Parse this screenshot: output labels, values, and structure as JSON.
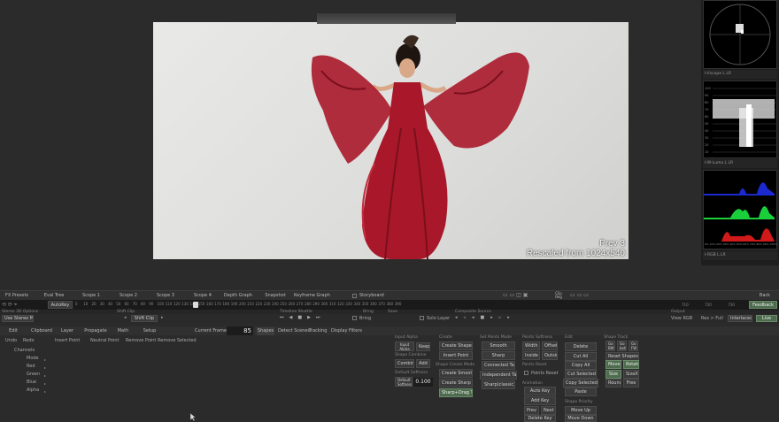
{
  "viewer": {
    "overlay_title": "Prev 3",
    "overlay_sub": "Rescaled from 1024x540"
  },
  "scopes": {
    "vscope_label": "I-Vscope  L LR",
    "luma_label": "I-W-Luma  L LR",
    "rgb_label": "I-RGB  L LR",
    "luma_ticks": [
      "100",
      "90",
      "80",
      "70",
      "60",
      "50",
      "40",
      "30",
      "20",
      "10"
    ],
    "rgb_ticks": [
      "0%",
      "10%",
      "20%",
      "30%",
      "40%",
      "50%",
      "60%",
      "70%",
      "80%",
      "90%",
      "100%"
    ]
  },
  "toolbar": {
    "tabs": [
      "FX Presets",
      "Eval Tree",
      "Scope 1",
      "Scope 2",
      "Scope 3",
      "Scope 4",
      "Depth Graph",
      "Snapshot",
      "Keyframe Graph"
    ],
    "storyboard": "Storyboard",
    "clip_reg": "Clip\nReg",
    "back": "Back"
  },
  "timeline": {
    "autokey": "AutoKey",
    "ticks": [
      "0",
      "10",
      "20",
      "30",
      "40",
      "50",
      "60",
      "70",
      "80",
      "90",
      "100",
      "110",
      "120",
      "130",
      "140",
      "150",
      "160",
      "170",
      "180",
      "190",
      "200",
      "210",
      "220",
      "230",
      "240",
      "250",
      "260",
      "270",
      "280",
      "290",
      "300",
      "310",
      "320",
      "330",
      "340",
      "350",
      "360",
      "370",
      "380",
      "390"
    ],
    "feedback": "Feedback",
    "end_ticks": [
      "710",
      "720",
      "730"
    ]
  },
  "row3": {
    "stereo": "Stereo 3D Options",
    "shift_clip_hdr": "Shift Clip",
    "timeline_shuttle": "Timeline Shuttle",
    "bring": "Bring",
    "save": "Save",
    "composite_source": "Composite Source",
    "output": "Output"
  },
  "row4": {
    "use_stereo": "Use Stereo Mode",
    "shift_clip": "Shift Clip",
    "bring": "Bring",
    "solo_layer": "Solo Layer",
    "view_rgb": "View  RGB",
    "res_full": "Res > Full",
    "interlaced": "Interlaced",
    "live": "Live"
  },
  "tabs2": {
    "items": [
      "Edit",
      "Clipboard",
      "Layer",
      "Propagate",
      "Math",
      "Setup"
    ],
    "current_frame_label": "Current Frame",
    "current_frame": "85",
    "right": [
      "Shapes",
      "Detect Scenes",
      "Tracking",
      "Display Filters"
    ]
  },
  "left_panel": {
    "undo": "Undo",
    "redo": "Redo",
    "insert_point": "Insert Point",
    "neutral_point": "Neutral Point",
    "remove_point": "Remove Point",
    "remove_selected": "Remove Selected",
    "channels_label": "Channels",
    "channels": [
      "Mode",
      "Red",
      "Green",
      "Blue",
      "Alpha"
    ]
  },
  "right_panel": {
    "input_alpha_hdr": "Input Alpha",
    "input_alpha": "Input Alpha",
    "keep": "Keep",
    "shape_combine_hdr": "Shape Combine",
    "combine": "Combine",
    "add": "Add",
    "default_softness_hdr": "Default Softness",
    "default_softness": "Default Softness",
    "softness_val": "0.100",
    "create_hdr": "Create",
    "create_shape": "Create Shape",
    "insert_point": "Insert Point",
    "shape_create_mode_hdr": "Shape Create Mode",
    "create_smooth": "Create Smooth",
    "create_sharp": "Create Sharp",
    "sharp_drag": "Sharp+Drag Tang",
    "set_points_mode_hdr": "Set Points Mode",
    "smooth": "Smooth",
    "sharp": "Sharp",
    "connected_tang": "Connected Tang",
    "independent_tang": "Independent Tang",
    "sharp_classic": "Sharp(classic)",
    "points_softness_hdr": "Points Softness",
    "width": "Width",
    "offset": "Offset",
    "inside": "Inside",
    "outside": "Outside",
    "points_reset_hdr": "Points Reset",
    "points_reset": "Points Reset",
    "animation_hdr": "Animation",
    "auto_key": "Auto Key",
    "add_key": "Add Key",
    "prev": "Prev",
    "next": "Next",
    "delete_key": "Delete Key",
    "edit_hdr": "Edit",
    "delete": "Delete",
    "cut_all": "Cut All",
    "copy_all": "Copy All",
    "cut_selected": "Cut Selected",
    "copy_selected": "Copy Selected",
    "paste": "Paste",
    "shape_priority_hdr": "Shape Priority",
    "move_up": "Move Up",
    "move_down": "Move Down",
    "shape_track_hdr": "Shape Track",
    "go_bw": "Go BW",
    "go_both": "Go both",
    "go_fw": "Go FW",
    "reset_shapes": "Reset Shapes",
    "move": "Move",
    "rotate": "Rotate",
    "size": "Size",
    "size_xy": "SizeXY",
    "round": "Round",
    "free": "Free"
  },
  "colors": {
    "accent_green": "#4f6b4f",
    "dress_red": "#a8182a"
  }
}
